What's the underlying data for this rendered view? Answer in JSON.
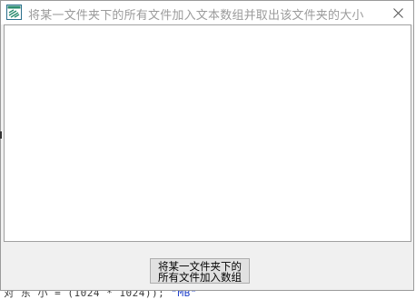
{
  "window": {
    "title": "将某一文件夹下的所有文件加入文本数组并取出该文件夹的大小",
    "icon": "app-form-icon",
    "close_icon": "close-icon"
  },
  "listbox": {
    "items": []
  },
  "button": {
    "label": "将某一文件夹下的\n所有文件加入数组"
  },
  "background_fragment": {
    "text_prefix": "i 对 东 小 ",
    "text_code": " = (1024 * 1024)); ",
    "text_str": "\"MB\""
  },
  "colors": {
    "window_bg": "#f0f0f0",
    "title_text": "#9b9b9b",
    "button_bg": "#e1e1e1",
    "icon_accent": "#2a8c6e"
  }
}
